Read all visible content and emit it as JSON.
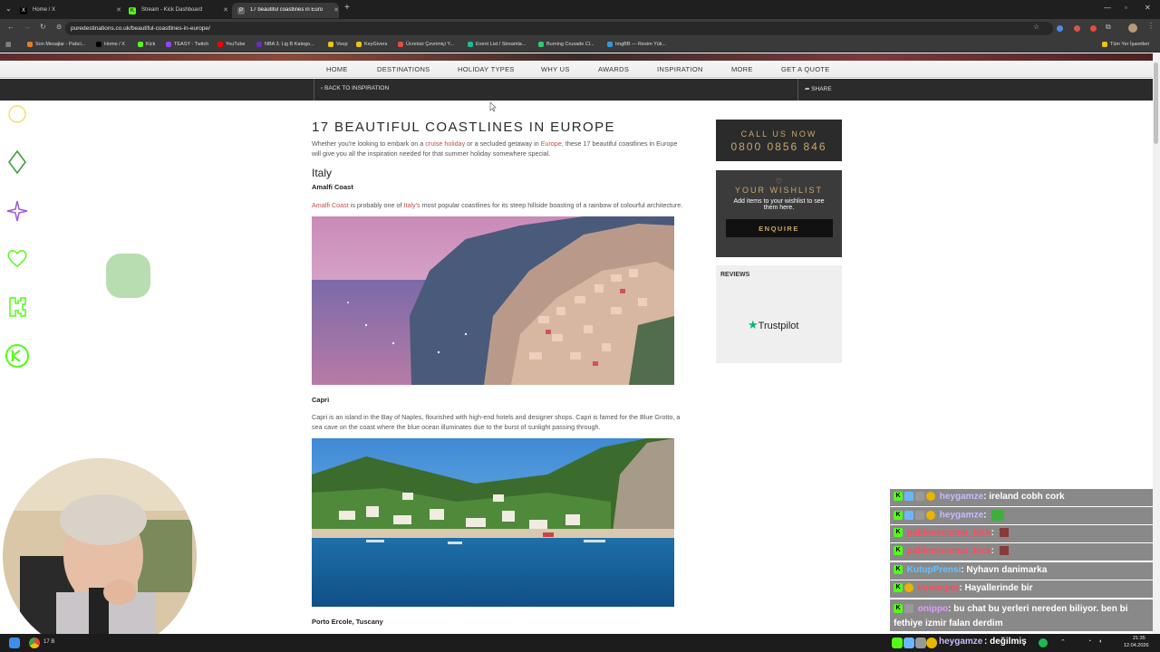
{
  "browser": {
    "tabs": [
      {
        "label": "Home / X",
        "active": false
      },
      {
        "label": "Stream - Kick Dashboard",
        "active": false
      },
      {
        "label": "17 beautiful coastlines in Europe",
        "active": true
      }
    ],
    "url": "puredestinations.co.uk/beautiful-coastlines-in-europe/",
    "bookmarks": [
      "Son Mesajlar - Pabci...",
      "Home / X",
      "Kick",
      "TEASY - Twitch",
      "YouTube",
      "NBA 3. Lig B Katego...",
      "Voop",
      "KeyGivers",
      "Ücretsiz Çevrimiçi Y...",
      "Event List / Streamla...",
      "Burning Crusade Cl...",
      "ImgBB — Resim Yük..."
    ],
    "all_bookmarks": "Tüm Yer İşaretleri"
  },
  "site_nav": {
    "links": [
      "HOME",
      "DESTINATIONS",
      "HOLIDAY TYPES",
      "WHY US",
      "AWARDS",
      "INSPIRATION",
      "MORE",
      "GET A QUOTE"
    ],
    "back": "BACK TO INSPIRATION",
    "share": "SHARE"
  },
  "article": {
    "title": "17 BEAUTIFUL COASTLINES IN EUROPE",
    "intro_a": "Whether you're looking to embark on a ",
    "intro_link1": "cruise holiday",
    "intro_b": " or a secluded getaway in ",
    "intro_link2": "Europe",
    "intro_c": ", these 17 beautiful coastlines in Europe",
    "intro_line2": "will give you all the inspiration needed for that summer holiday somewhere special.",
    "country": "Italy",
    "sections": [
      {
        "heading": "Amalfi Coast",
        "link1": "Amalfi Coast",
        "mid": " is probably one of ",
        "link2": "Italy's",
        "rest": " most popular coastlines for its steep hillside boasting of a rainbow of colourful architecture."
      },
      {
        "heading": "Capri",
        "line1": "Capri is an island in the Bay of Naples, flourished with high-end hotels and designer shops. Capri is famed for the Blue Grotto, a",
        "line2": "sea cave on the coast where the blue ocean illuminates due to the burst of sunlight passing through."
      },
      {
        "heading": "Porto Ercole, Tuscany"
      }
    ]
  },
  "sidebar": {
    "call_label": "CALL US NOW",
    "phone": "0800 0856 846",
    "wishlist_title": "YOUR WISHLIST",
    "wishlist_text_1": "Add items to your wishlist to see",
    "wishlist_text_2": "them here.",
    "enquire": "ENQUIRE",
    "reviews": "REVIEWS",
    "trustpilot": "Trustpilot"
  },
  "chat": [
    {
      "user": "heygamze",
      "msg": ": ireland cobh cork",
      "style": "a"
    },
    {
      "user": "heygamze",
      "msg": ":",
      "style": "a"
    },
    {
      "user": "pabloescomar_kick",
      "msg": ":",
      "style": "b"
    },
    {
      "user": "pabloescomar_kick",
      "msg": ":",
      "style": "b"
    },
    {
      "user": "KutupPrensi",
      "msg": ": Nyhavn danimarka",
      "style": "c"
    },
    {
      "user": "bynonper",
      "msg": ": Hayallerinde bir",
      "style": "b"
    },
    {
      "user": "onippo",
      "msg": ": bu chat bu yerleri nereden biliyor. ben bi",
      "style": "e"
    },
    {
      "user": "",
      "msg": "fethiye izmir falan derdim",
      "style": "e"
    },
    {
      "user": "heygamze",
      "msg": ": değilmiş",
      "style": "a"
    }
  ],
  "taskbar": {
    "time": "21:35",
    "date": "12.04.2026",
    "app_label": "17 B"
  },
  "colors": {
    "accent": "#c0504d",
    "dark_panel": "#2b2b2b",
    "gold": "#c8a96a",
    "trustpilot": "#00b67a",
    "kick_green": "#53fc18"
  }
}
